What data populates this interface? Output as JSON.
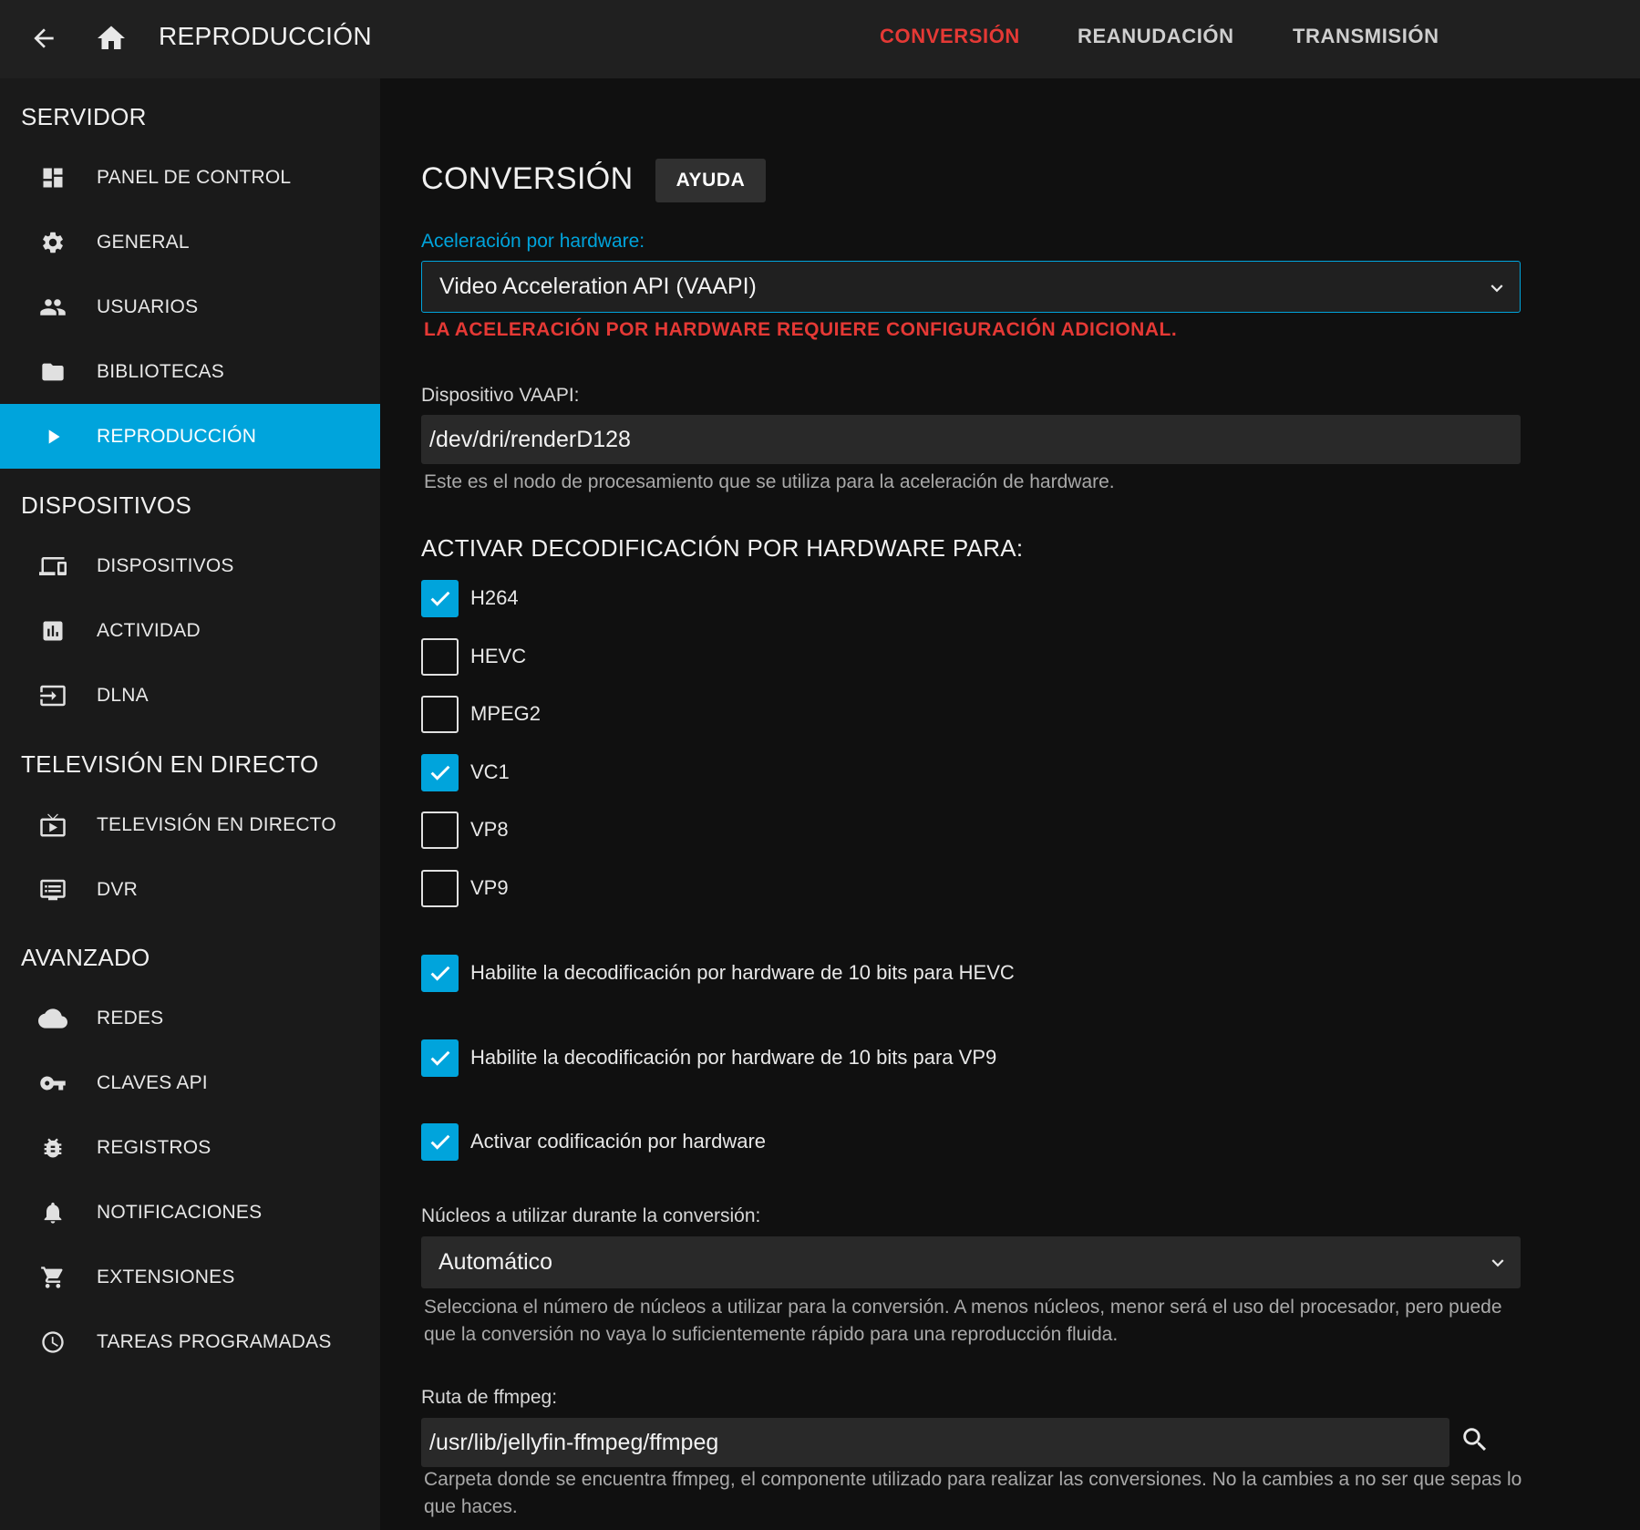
{
  "header": {
    "title": "REPRODUCCIÓN",
    "back_icon": "arrow-left-icon",
    "home_icon": "home-icon",
    "tabs": [
      {
        "label": "CONVERSIÓN",
        "active": true
      },
      {
        "label": "REANUDACIÓN",
        "active": false
      },
      {
        "label": "TRANSMISIÓN",
        "active": false
      }
    ]
  },
  "sidebar": {
    "sections": [
      {
        "title": "SERVIDOR",
        "items": [
          {
            "label": "PANEL DE CONTROL",
            "icon": "dashboard-icon"
          },
          {
            "label": "GENERAL",
            "icon": "gear-icon"
          },
          {
            "label": "USUARIOS",
            "icon": "people-icon"
          },
          {
            "label": "BIBLIOTECAS",
            "icon": "folder-icon"
          },
          {
            "label": "REPRODUCCIÓN",
            "icon": "play-icon",
            "active": true
          }
        ]
      },
      {
        "title": "DISPOSITIVOS",
        "items": [
          {
            "label": "DISPOSITIVOS",
            "icon": "devices-icon"
          },
          {
            "label": "ACTIVIDAD",
            "icon": "activity-chart-icon"
          },
          {
            "label": "DLNA",
            "icon": "input-icon"
          }
        ]
      },
      {
        "title": "TELEVISIÓN EN DIRECTO",
        "items": [
          {
            "label": "TELEVISIÓN EN DIRECTO",
            "icon": "live-tv-icon"
          },
          {
            "label": "DVR",
            "icon": "dvr-icon"
          }
        ]
      },
      {
        "title": "AVANZADO",
        "items": [
          {
            "label": "REDES",
            "icon": "cloud-icon"
          },
          {
            "label": "CLAVES API",
            "icon": "key-icon"
          },
          {
            "label": "REGISTROS",
            "icon": "bug-icon"
          },
          {
            "label": "NOTIFICACIONES",
            "icon": "bell-icon"
          },
          {
            "label": "EXTENSIONES",
            "icon": "cart-icon"
          },
          {
            "label": "TAREAS PROGRAMADAS",
            "icon": "clock-icon"
          }
        ]
      }
    ]
  },
  "main": {
    "title": "CONVERSIÓN",
    "help_label": "AYUDA",
    "hw_accel": {
      "label": "Aceleración por hardware:",
      "value": "Video Acceleration API (VAAPI)",
      "warning": "LA ACELERACIÓN POR HARDWARE REQUIERE CONFIGURACIÓN ADICIONAL."
    },
    "vaapi_device": {
      "label": "Dispositivo VAAPI:",
      "value": "/dev/dri/renderD128",
      "helper": "Este es el nodo de procesamiento que se utiliza para la aceleración de hardware."
    },
    "decode_heading": "ACTIVAR DECODIFICACIÓN POR HARDWARE PARA:",
    "codecs": [
      {
        "label": "H264",
        "checked": true
      },
      {
        "label": "HEVC",
        "checked": false
      },
      {
        "label": "MPEG2",
        "checked": false
      },
      {
        "label": "VC1",
        "checked": true
      },
      {
        "label": "VP8",
        "checked": false
      },
      {
        "label": "VP9",
        "checked": false
      }
    ],
    "options": [
      {
        "label": "Habilite la decodificación por hardware de 10 bits para HEVC",
        "checked": true
      },
      {
        "label": "Habilite la decodificación por hardware de 10 bits para VP9",
        "checked": true
      },
      {
        "label": "Activar codificación por hardware",
        "checked": true
      }
    ],
    "threads": {
      "label": "Núcleos a utilizar durante la conversión:",
      "value": "Automático",
      "helper": "Selecciona el número de núcleos a utilizar para la conversión. A menos núcleos, menor será el uso del procesador, pero puede que la conversión no vaya lo suficientemente rápido para una reproducción fluida."
    },
    "ffmpeg": {
      "label": "Ruta de ffmpeg:",
      "value": "/usr/lib/jellyfin-ffmpeg/ffmpeg",
      "helper": "Carpeta donde se encuentra ffmpeg, el componente utilizado para realizar las conversiones. No la cambies a no ser que sepas lo que haces.",
      "search_icon": "search-icon"
    }
  },
  "colors": {
    "accent": "#00a4dc",
    "active_tab": "#e53935",
    "warning": "#e53935",
    "header_bg": "#202020",
    "sidebar_bg": "#1a1a1a",
    "main_bg": "#101010"
  }
}
